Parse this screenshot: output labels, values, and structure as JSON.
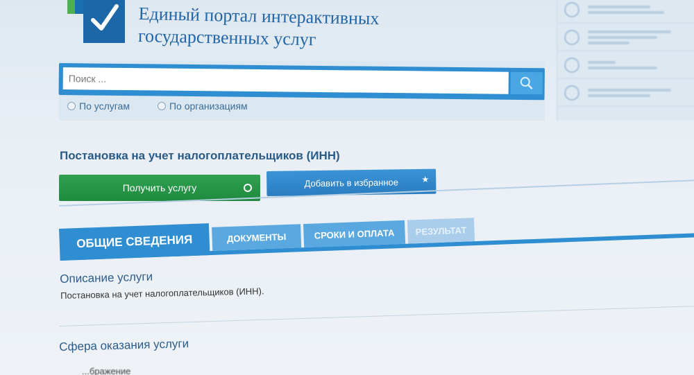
{
  "header": {
    "logo_line1": "Единый портал интерактивных",
    "logo_line2": "государственных услуг"
  },
  "search": {
    "placeholder": "Поиск ...",
    "radio_services": "По услугам",
    "radio_orgs": "По организациям"
  },
  "service": {
    "title": "Постановка на учет налогоплательщиков (ИНН)",
    "get_button": "Получить услугу",
    "favorite_button": "Добавить в избранное"
  },
  "tabs": [
    "ОБЩИЕ СВЕДЕНИЯ",
    "ДОКУМЕНТЫ",
    "СРОКИ И ОПЛАТА",
    "РЕЗУЛЬТАТ"
  ],
  "content": {
    "description_heading": "Описание услуги",
    "description_text": "Постановка на учет налогоплательщиков (ИНН).",
    "scope_heading": "Сфера оказания услуги",
    "scope_text": "...бражение"
  },
  "colors": {
    "brand_blue": "#2f8ed1",
    "green": "#1f8a3e",
    "title_blue": "#2166a6"
  },
  "icons": [
    "checkmark-icon",
    "search-icon",
    "star-icon",
    "circle-arrow-icon",
    "contact-icon",
    "phone-icon",
    "document-icon"
  ]
}
